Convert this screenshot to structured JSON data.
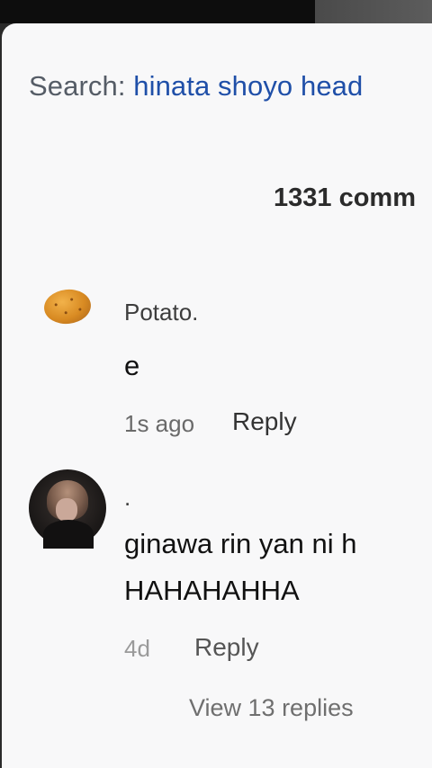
{
  "search": {
    "label": "Search:",
    "query": "hinata shoyo head"
  },
  "comments_header": {
    "count_text": "1331 comm"
  },
  "comments": [
    {
      "username": "Potato.",
      "text_lines": [
        "e"
      ],
      "time": "1s ago",
      "reply_label": "Reply",
      "avatar_icon": "potato-avatar-icon"
    },
    {
      "username": ".",
      "text_lines": [
        "ginawa rin yan ni h",
        "HAHAHAHHA"
      ],
      "time": "4d",
      "reply_label": "Reply",
      "view_replies": "View 13 replies",
      "avatar_icon": "user-avatar-icon"
    }
  ],
  "colors": {
    "sheet_bg": "#f8f8f9",
    "search_query": "#1f4fa8",
    "search_label": "#555c66",
    "top_bar": "#0d0d0d"
  }
}
